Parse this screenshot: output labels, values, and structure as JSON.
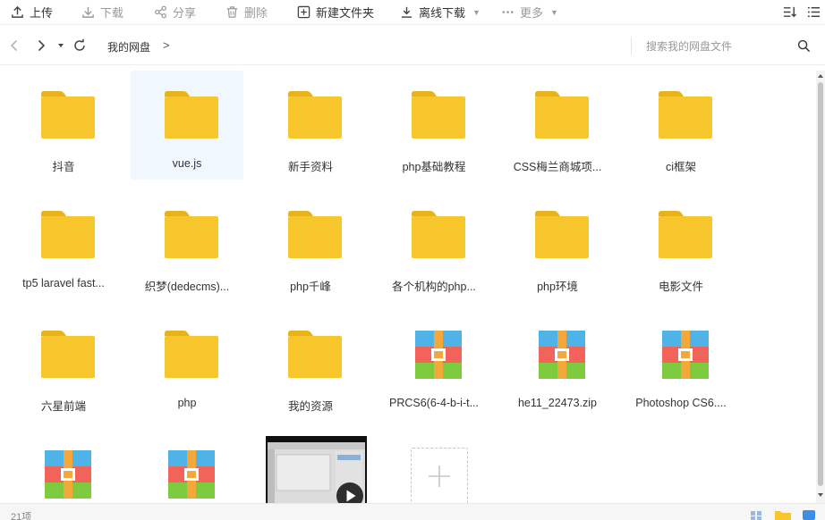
{
  "toolbar": {
    "upload": "上传",
    "download": "下载",
    "share": "分享",
    "delete": "删除",
    "new_folder": "新建文件夹",
    "offline_download": "离线下载",
    "more": "更多"
  },
  "address": {
    "crumb": "我的网盘",
    "separator": ">",
    "search_placeholder": "搜索我的网盘文件"
  },
  "files": [
    {
      "name": "抖音",
      "type": "folder"
    },
    {
      "name": "vue.js",
      "type": "folder",
      "selected": true
    },
    {
      "name": "新手资料",
      "type": "folder"
    },
    {
      "name": "php基础教程",
      "type": "folder"
    },
    {
      "name": "CSS梅兰商城项...",
      "type": "folder"
    },
    {
      "name": "ci框架",
      "type": "folder"
    },
    {
      "name": "tp5 laravel fast...",
      "type": "folder"
    },
    {
      "name": "织梦(dedecms)...",
      "type": "folder"
    },
    {
      "name": "php千峰",
      "type": "folder"
    },
    {
      "name": "各个机构的php...",
      "type": "folder"
    },
    {
      "name": "php环境",
      "type": "folder"
    },
    {
      "name": "电影文件",
      "type": "folder"
    },
    {
      "name": "六星前端",
      "type": "folder"
    },
    {
      "name": "php",
      "type": "folder"
    },
    {
      "name": "我的资源",
      "type": "folder"
    },
    {
      "name": "PRCS6(6-4-b-i-t...",
      "type": "archive"
    },
    {
      "name": "he11_22473.zip",
      "type": "archive"
    },
    {
      "name": "Photoshop CS6....",
      "type": "archive"
    },
    {
      "name": "",
      "type": "archive"
    },
    {
      "name": "",
      "type": "archive"
    }
  ],
  "status": {
    "count": "21项"
  },
  "colors": {
    "folder": "#f7c52c",
    "folder_tab": "#e8b21a",
    "selected_bg": "#f1f7fe",
    "archive_blue": "#4fb3e8",
    "archive_red": "#f2645a",
    "archive_green": "#7ecb40",
    "archive_strap": "#f3a93a"
  }
}
